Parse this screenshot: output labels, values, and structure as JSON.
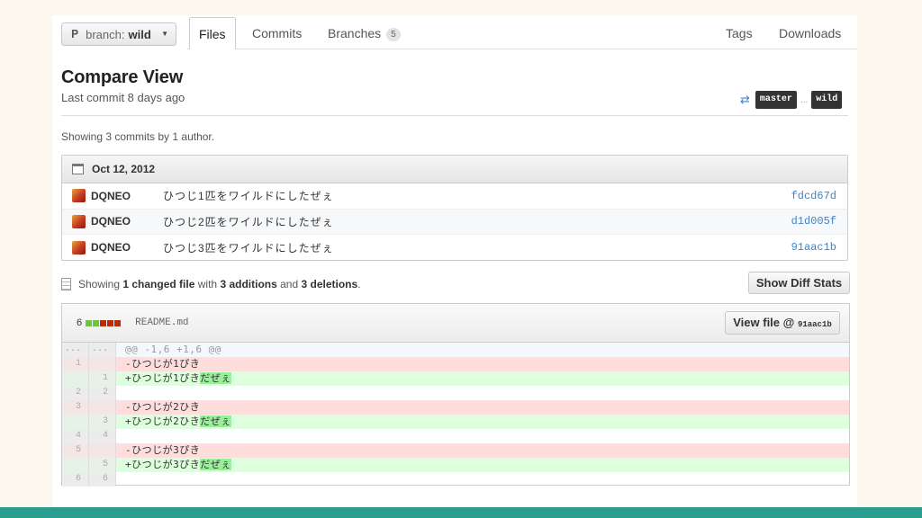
{
  "branch": {
    "prefix": "branch:",
    "value": "wild"
  },
  "tabs": [
    {
      "label": "Files"
    },
    {
      "label": "Commits"
    },
    {
      "label": "Branches",
      "count": "5"
    },
    {
      "label": "Tags"
    },
    {
      "label": "Downloads"
    }
  ],
  "header": {
    "title": "Compare View",
    "subtitle": "Last commit 8 days ago",
    "base": "master",
    "dots": "...",
    "head": "wild"
  },
  "showing": "Showing 3 commits by 1 author.",
  "commits": {
    "date": "Oct 12, 2012",
    "rows": [
      {
        "author": "DQNEO",
        "message": "ひつじ1匹をワイルドにしたぜぇ",
        "sha": "fdcd67d"
      },
      {
        "author": "DQNEO",
        "message": "ひつじ2匹をワイルドにしたぜぇ",
        "sha": "d1d005f"
      },
      {
        "author": "DQNEO",
        "message": "ひつじ3匹をワイルドにしたぜぇ",
        "sha": "91aac1b"
      }
    ]
  },
  "summary": {
    "pre": "Showing",
    "files": "1 changed file",
    "mid": "with",
    "additions": "3 additions",
    "and": "and",
    "deletions": "3 deletions",
    "end": "."
  },
  "show_diff_stats": "Show Diff Stats",
  "diff": {
    "stat_count": "6",
    "filename": "README.md",
    "view_file": "View file @",
    "view_sha": "91aac1b",
    "lines": [
      {
        "type": "hunk",
        "old": "...",
        "new": "...",
        "text": "@@ -1,6 +1,6 @@"
      },
      {
        "type": "del",
        "old": "1",
        "new": "",
        "text": "-ひつじが1ぴき"
      },
      {
        "type": "add",
        "old": "",
        "new": "1",
        "text": "+ひつじが1ぴき",
        "extra": "だぜぇ"
      },
      {
        "type": "ctx",
        "old": "2",
        "new": "2",
        "text": ""
      },
      {
        "type": "del",
        "old": "3",
        "new": "",
        "text": "-ひつじが2ひき"
      },
      {
        "type": "add",
        "old": "",
        "new": "3",
        "text": "+ひつじが2ひき",
        "extra": "だぜぇ"
      },
      {
        "type": "ctx",
        "old": "4",
        "new": "4",
        "text": ""
      },
      {
        "type": "del",
        "old": "5",
        "new": "",
        "text": "-ひつじが3ぴき"
      },
      {
        "type": "add",
        "old": "",
        "new": "5",
        "text": "+ひつじが3ぴき",
        "extra": "だぜぇ"
      },
      {
        "type": "ctx",
        "old": "6",
        "new": "6",
        "text": ""
      }
    ]
  },
  "colors": {
    "accent": "#4183c4",
    "bottom_bar": "#2a9d8f",
    "add_bg": "#ddffdd",
    "del_bg": "#ffdddd"
  }
}
